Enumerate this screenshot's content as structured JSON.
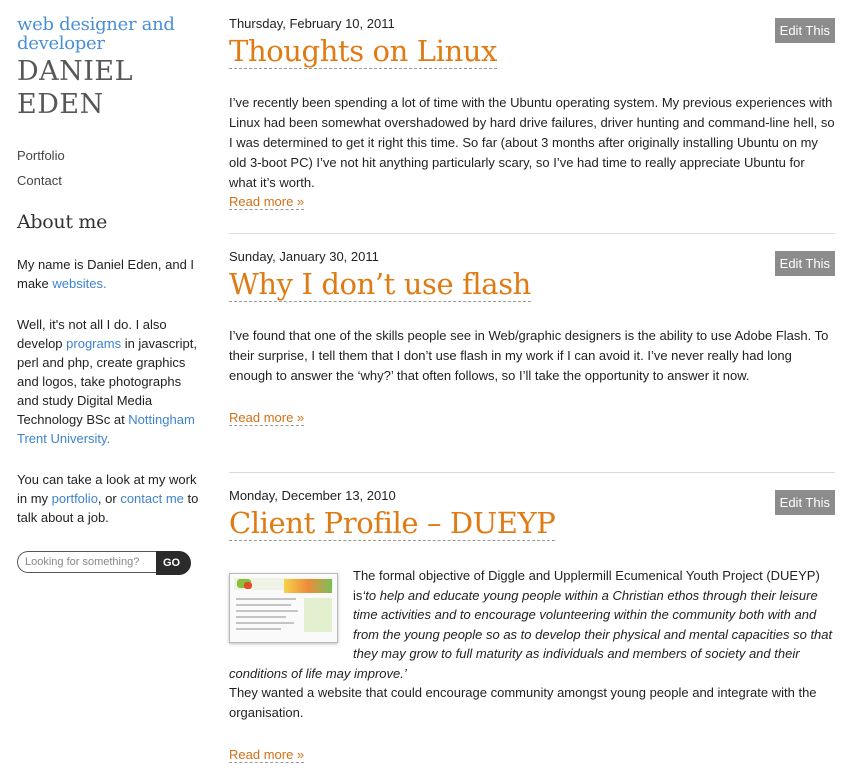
{
  "site": {
    "tagline": "web designer and developer",
    "name": "DANIEL EDEN"
  },
  "nav": [
    "Portfolio",
    "Contact"
  ],
  "about": {
    "title": "About me",
    "p1_text": "My name is Daniel Eden, and I make ",
    "p1_link": "websites.",
    "p2_text_a": "Well, it's not all I do. I also develop ",
    "p2_link_a": "programs",
    "p2_text_b": " in javascript, perl and php, create graphics and logos, take photographs and study Digital Media Technology BSc at ",
    "p2_link_b": "Nottingham Trent University.",
    "p3_text_a": "You can take a look at my work in my ",
    "p3_link_a": "portfolio",
    "p3_text_b": ", or ",
    "p3_link_b": "contact me",
    "p3_text_c": " to talk about a job."
  },
  "search": {
    "placeholder": "Looking for something?",
    "button": "GO"
  },
  "colors": {
    "title_orange": "#e07b14",
    "link_blue": "#3d83d0",
    "edit_grey": "#8c8c8c"
  },
  "posts": [
    {
      "date": "Thursday, February 10, 2011",
      "title": "Thoughts on Linux",
      "edit": "Edit This",
      "body": "I’ve recently been spending a lot of time with the Ubuntu operating system. My previous experiences with Linux had been somewhat overshadowed by hard drive failures, driver hunting and command-line hell, so I was determined to get it right this time. So far (about 3 months after originally installing Ubuntu on my old 3-boot PC) I’ve not hit anything particularly scary, so I’ve had time to really appreciate Ubuntu for what it’s worth.",
      "read_more": "Read more »"
    },
    {
      "date": "Sunday, January 30, 2011",
      "title": "Why I don’t use flash",
      "edit": "Edit This",
      "body": "I’ve found that one of the skills people see in Web/graphic designers is the ability to use Adobe Flash. To their surprise, I tell them that I don’t use flash in my work if I can avoid it. I’ve never really had long enough to answer the ‘why?’ that often follows, so I’ll take the opportunity to answer it now.",
      "read_more": "Read more »"
    },
    {
      "date": "Monday, December 13, 2010",
      "title": "Client Profile – DUEYP",
      "edit": "Edit This",
      "body_intro": "The formal objective of Diggle and Upplermill Ecumenical Youth Project (DUEYP) is",
      "body_quote": "‘to help and educate young people within a Christian ethos through their leisure time activities and to encourage volunteering within the community both with and from the young people so as to develop their physical and mental capacities so that they may grow to full maturity as individuals and members of society and their conditions of life may improve.’",
      "body_extra": "They wanted a website that could encourage community amongst young people and integrate with the organisation.",
      "read_more": "Read more »"
    }
  ]
}
